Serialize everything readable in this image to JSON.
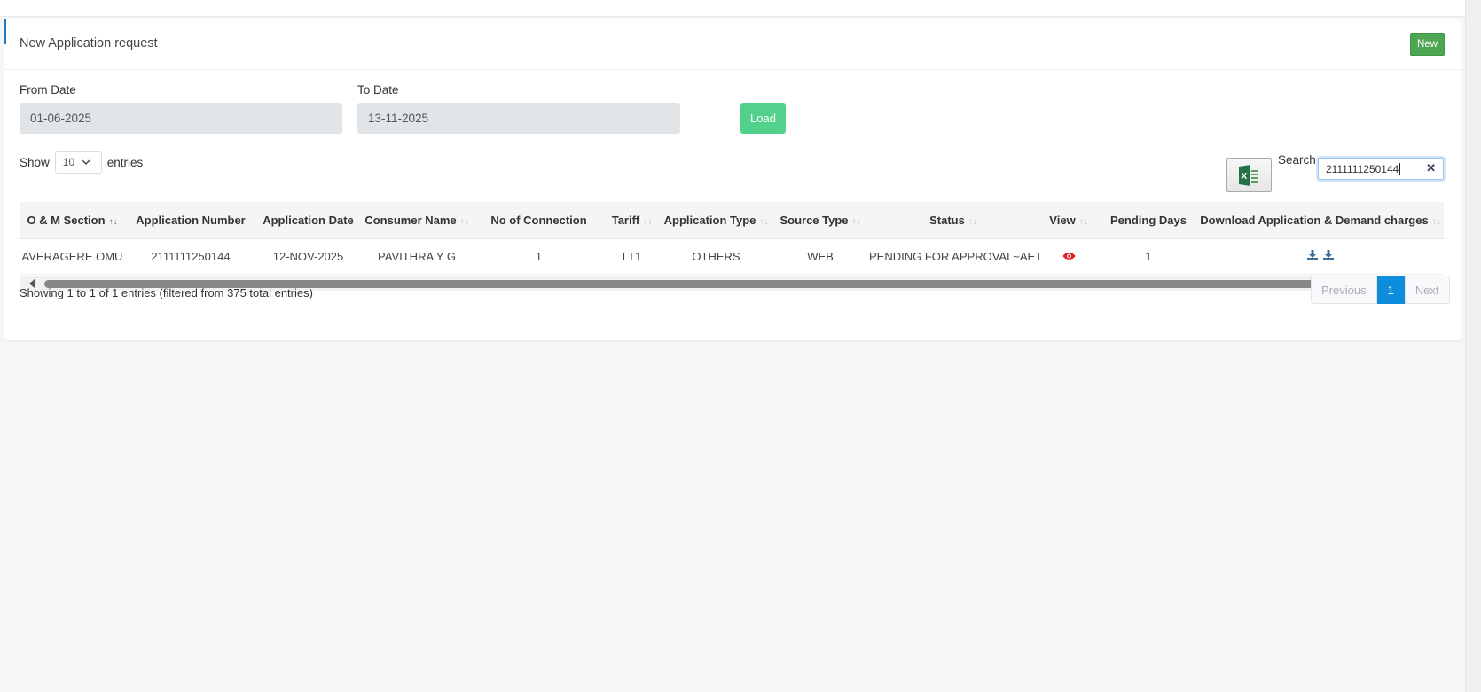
{
  "header": {
    "title": "New Application request",
    "new_label": "New"
  },
  "filters": {
    "from_label": "From Date",
    "from_value": "01-06-2025",
    "to_label": "To Date",
    "to_value": "13-11-2025",
    "load_label": "Load"
  },
  "length": {
    "show": "Show",
    "value": "10",
    "entries": "entries"
  },
  "search": {
    "label": "Search:",
    "value": "2111111250144"
  },
  "table": {
    "columns": [
      "O & M Section",
      "Application Number",
      "Application Date",
      "Consumer Name",
      "No of Connection",
      "Tariff",
      "Application Type",
      "Source Type",
      "Status",
      "View",
      "Pending Days",
      "Download Application & Demand charges"
    ],
    "rows": [
      [
        "AVERAGERE OMU",
        "2111111250144",
        "12-NOV-2025",
        "PAVITHRA Y G",
        "1",
        "LT1",
        "OTHERS",
        "WEB",
        "PENDING FOR APPROVAL~AET",
        "",
        "1",
        ""
      ]
    ]
  },
  "footer": {
    "info": "Showing 1 to 1 of 1 entries (filtered from 375 total entries)",
    "previous": "Previous",
    "page": "1",
    "next": "Next"
  },
  "colors": {
    "accent": "#1e7bbf",
    "new": "#4ea652",
    "load": "#52d18c",
    "page_active": "#0d8ddb",
    "view_icon": "#e02020"
  }
}
